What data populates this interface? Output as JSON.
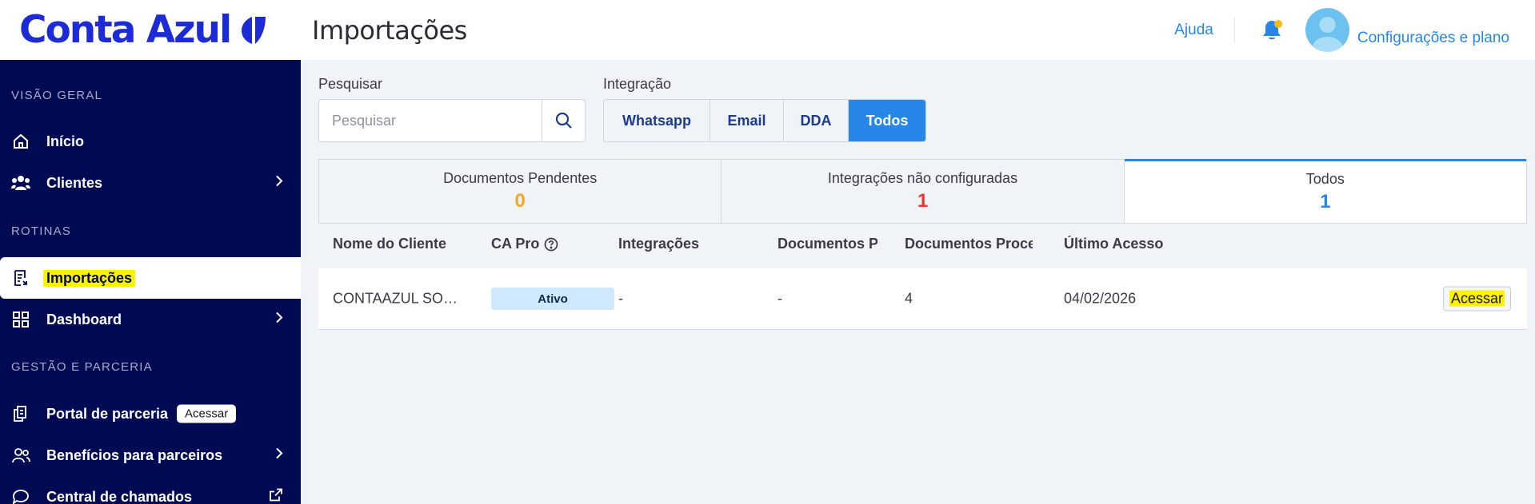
{
  "brand": {
    "name": "Conta Azul",
    "color": "#1d2bd6"
  },
  "header": {
    "title": "Importações",
    "help": "Ajuda",
    "config": "Configurações e plano",
    "notification_dot_color": "#f6b90e"
  },
  "sidebar": {
    "sections": [
      {
        "label": "VISÃO GERAL"
      },
      {
        "label": "ROTINAS"
      },
      {
        "label": "GESTÃO E PARCERIA"
      }
    ],
    "items": [
      {
        "label": "Início",
        "icon": "home-icon"
      },
      {
        "label": "Clientes",
        "icon": "users-icon"
      },
      {
        "label": "Importações",
        "icon": "import-document-icon",
        "active": true
      },
      {
        "label": "Dashboard",
        "icon": "grid-icon"
      },
      {
        "label": "Portal de parceria",
        "icon": "documents-icon",
        "badge": "Acessar"
      },
      {
        "label": "Benefícios para parceiros",
        "icon": "partner-users-icon"
      },
      {
        "label": "Central de chamados",
        "icon": "chat-icon"
      }
    ]
  },
  "filters": {
    "search_label": "Pesquisar",
    "search_placeholder": "Pesquisar",
    "integration_label": "Integração",
    "integration_options": [
      "Whatsapp",
      "Email",
      "DDA",
      "Todos"
    ],
    "selected": "Todos"
  },
  "tabs": [
    {
      "label": "Documentos Pendentes",
      "count": "0",
      "color": "#f5a623"
    },
    {
      "label": "Integrações não configuradas",
      "count": "1",
      "color": "#e53935"
    },
    {
      "label": "Todos",
      "count": "1",
      "color": "#2687e9",
      "active": true
    }
  ],
  "table": {
    "columns": [
      "Nome do Cliente",
      "CA Pro",
      "Integrações",
      "Documentos Pe...",
      "Documentos Process...",
      "Último Acesso"
    ],
    "rows": [
      {
        "client": "CONTAAZUL SOFTWA...",
        "ca_pro": "Ativo",
        "integrations": "-",
        "pending_docs": "-",
        "processed_docs": "4",
        "last_access": "04/02/2026",
        "action": "Acessar"
      }
    ]
  },
  "colors": {
    "sidebar_bg": "#000a52",
    "accent": "#2687e9",
    "highlight": "#fff200"
  }
}
